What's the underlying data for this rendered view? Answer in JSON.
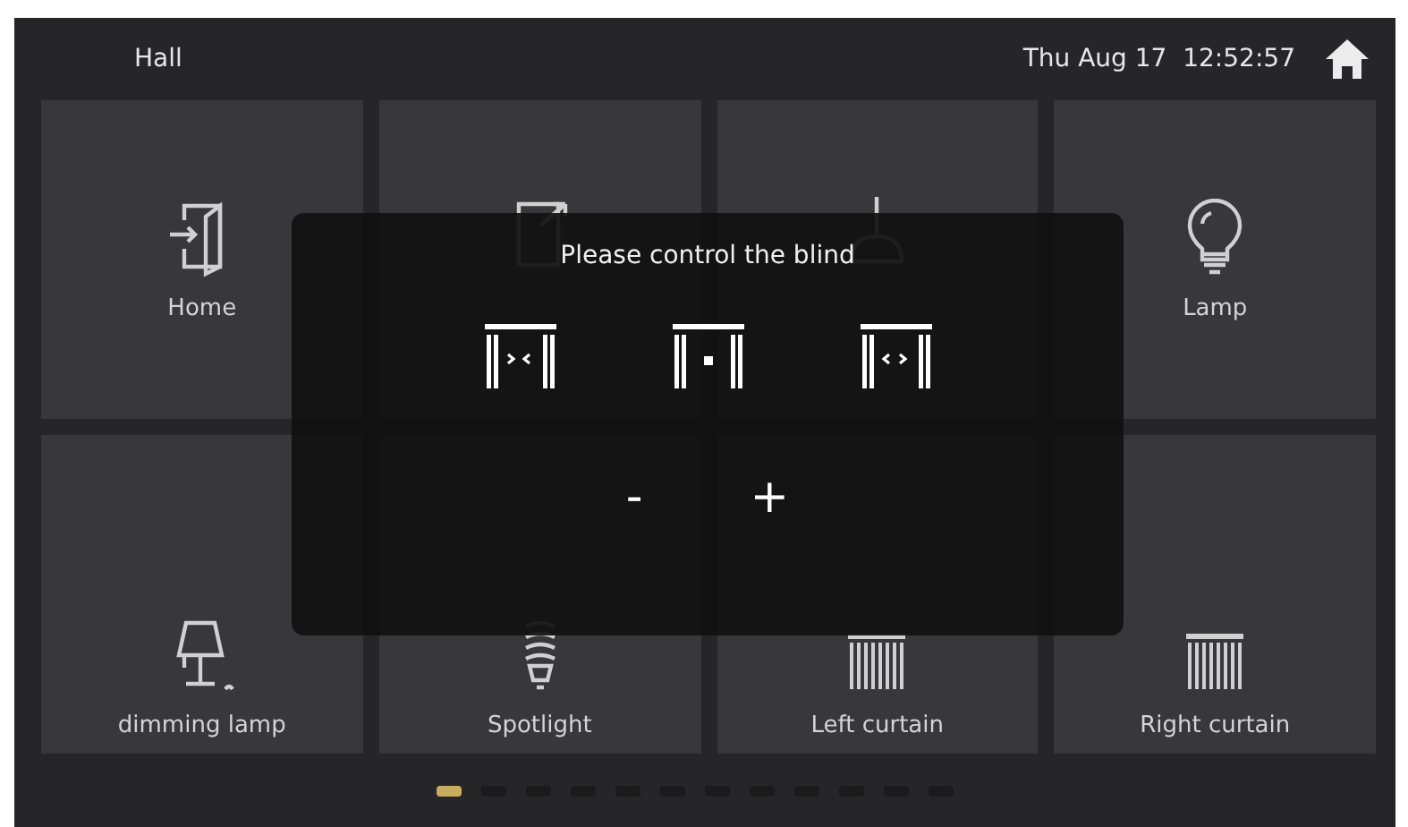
{
  "header": {
    "title": "Hall",
    "datetime": "Thu Aug 17  12:52:57"
  },
  "tiles": [
    {
      "label": "Home",
      "kind": "door_in"
    },
    {
      "kind": "door_out"
    },
    {
      "kind": "chandelier"
    },
    {
      "label": "Lamp",
      "kind": "bulb"
    },
    {
      "label": "dimming lamp",
      "kind": "table_lamp"
    },
    {
      "label": "Spotlight",
      "kind": "spiral_bulb"
    },
    {
      "label": "Left curtain",
      "kind": "curtain"
    },
    {
      "label": "Right curtain",
      "kind": "curtain"
    }
  ],
  "dialog": {
    "title": "Please control the blind",
    "curtain_buttons": [
      {
        "kind": "close"
      },
      {
        "kind": "stop"
      },
      {
        "kind": "open"
      }
    ],
    "step_buttons": [
      "-",
      "+"
    ]
  },
  "pages": [
    {
      "selected": true
    },
    {
      "selected": false
    },
    {
      "selected": false
    },
    {
      "selected": false
    },
    {
      "selected": false
    },
    {
      "selected": false
    },
    {
      "selected": false
    },
    {
      "selected": false
    },
    {
      "selected": false
    },
    {
      "selected": false
    },
    {
      "selected": false
    },
    {
      "selected": false
    }
  ]
}
